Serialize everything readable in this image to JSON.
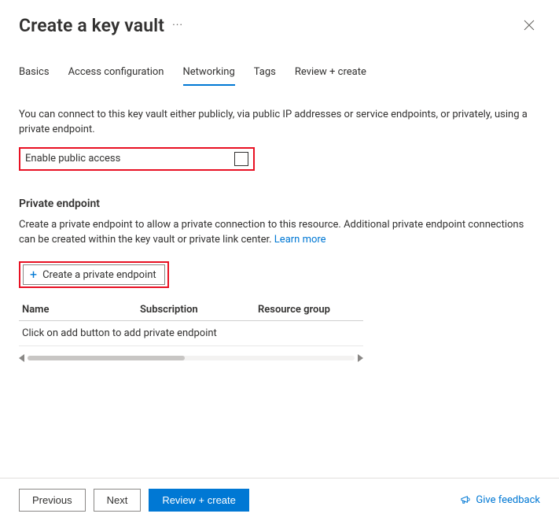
{
  "header": {
    "title": "Create a key vault",
    "more_actions_glyph": "···"
  },
  "tabs": [
    {
      "label": "Basics",
      "active": false
    },
    {
      "label": "Access configuration",
      "active": false
    },
    {
      "label": "Networking",
      "active": true
    },
    {
      "label": "Tags",
      "active": false
    },
    {
      "label": "Review + create",
      "active": false
    }
  ],
  "networking": {
    "intro": "You can connect to this key vault either publicly, via public IP addresses or service endpoints, or privately, using a private endpoint.",
    "public_access_label": "Enable public access",
    "public_access_checked": false,
    "private_endpoint_section_title": "Private endpoint",
    "private_endpoint_description_prefix": "Create a private endpoint to allow a private connection to this resource. Additional private endpoint connections can be created within the key vault or private link center.  ",
    "learn_more_label": "Learn more",
    "create_pe_button": "Create a private endpoint",
    "table": {
      "columns": [
        "Name",
        "Subscription",
        "Resource group"
      ],
      "empty_message": "Click on add button to add private endpoint"
    }
  },
  "footer": {
    "previous": "Previous",
    "next": "Next",
    "review_create": "Review + create",
    "feedback": "Give feedback"
  },
  "icons": {
    "close": "close-icon",
    "plus": "plus-icon",
    "megaphone": "megaphone-icon"
  },
  "colors": {
    "accent": "#0078d4",
    "highlight_border": "#e81123"
  }
}
